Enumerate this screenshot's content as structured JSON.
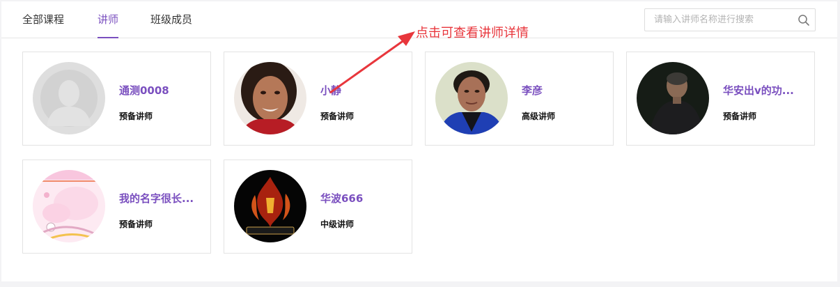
{
  "tabs": [
    {
      "label": "全部课程",
      "active": false
    },
    {
      "label": "讲师",
      "active": true
    },
    {
      "label": "班级成员",
      "active": false
    }
  ],
  "search": {
    "placeholder": "请输入讲师名称进行搜索",
    "icon": "search-icon"
  },
  "teachers": [
    {
      "name": "通测0008",
      "level": "预备讲师",
      "avatar": "default-avatar"
    },
    {
      "name": "小静",
      "level": "预备讲师",
      "avatar": "woman-portrait"
    },
    {
      "name": "李彦",
      "level": "高级讲师",
      "avatar": "woman-portrait-blue"
    },
    {
      "name": "华安出v的功...",
      "level": "预备讲师",
      "avatar": "monk-portrait"
    },
    {
      "name": "我的名字很长...",
      "level": "预备讲师",
      "avatar": "pink-illustration"
    },
    {
      "name": "华波666",
      "level": "中级讲师",
      "avatar": "soul-online-logo"
    }
  ],
  "annotation": {
    "text": "点击可查看讲师详情",
    "color": "#e8363c"
  },
  "colors": {
    "accent": "#7a4fbf",
    "annotation": "#e8363c",
    "border": "#e3e3e3"
  }
}
